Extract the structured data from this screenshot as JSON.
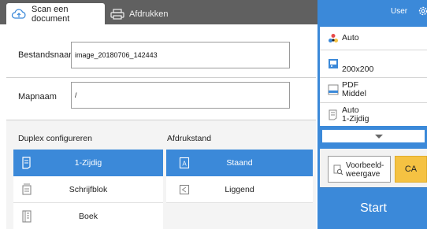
{
  "tabs": {
    "scan_label": "Scan een document",
    "print_label": "Afdrukken"
  },
  "user": {
    "label": "User"
  },
  "fields": {
    "filename_label": "Bestandsnaam",
    "filename_value": "image_20180706_142443",
    "folder_label": "Mapnaam",
    "folder_value": "/"
  },
  "duplex": {
    "label": "Duplex configureren",
    "options": [
      {
        "label": "1-Zijdig",
        "icon": "one-sided-icon",
        "selected": true
      },
      {
        "label": "Schrijfblok",
        "icon": "notepad-icon",
        "selected": false
      },
      {
        "label": "Boek",
        "icon": "book-icon",
        "selected": false
      }
    ]
  },
  "orientation": {
    "label": "Afdrukstand",
    "options": [
      {
        "label": "Staand",
        "icon": "portrait-icon",
        "selected": true
      },
      {
        "label": "Liggend",
        "icon": "landscape-icon",
        "selected": false
      }
    ]
  },
  "settings": {
    "color": "Auto",
    "resolution": "200x200",
    "format_line1": "PDF",
    "format_line2": "Middel",
    "sides_line1": "Auto",
    "sides_line2": "1-Zijdig"
  },
  "actions": {
    "preview_line1": "Voorbeeld-",
    "preview_line2": "weergave",
    "ca_label": "CA",
    "start_label": "Start"
  },
  "colors": {
    "accent": "#3b89d9",
    "topbar": "#606060",
    "ca": "#f5c242"
  }
}
